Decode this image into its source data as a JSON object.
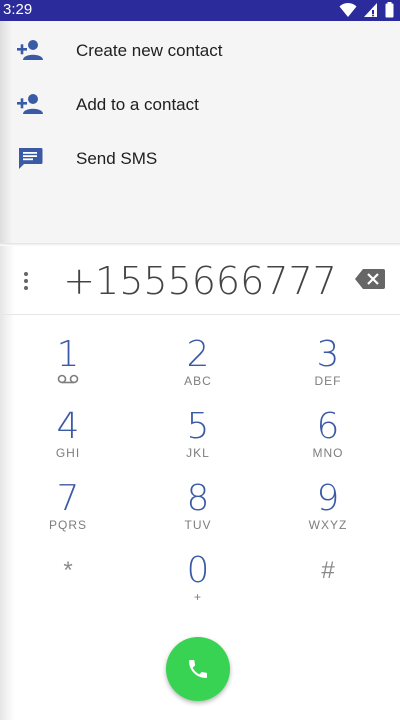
{
  "status_bar": {
    "time": "3:29",
    "icons": [
      "wifi-icon",
      "signal-icon",
      "battery-icon"
    ],
    "background": "#2b2b9b"
  },
  "actions": [
    {
      "label": "Create new contact",
      "icon": "person-add-icon"
    },
    {
      "label": "Add to a contact",
      "icon": "person-add-icon"
    },
    {
      "label": "Send SMS",
      "icon": "message-icon"
    }
  ],
  "dialer": {
    "number": "+1555666777",
    "keys": [
      {
        "digit": "1",
        "letters": ""
      },
      {
        "digit": "2",
        "letters": "ABC"
      },
      {
        "digit": "3",
        "letters": "DEF"
      },
      {
        "digit": "4",
        "letters": "GHI"
      },
      {
        "digit": "5",
        "letters": "JKL"
      },
      {
        "digit": "6",
        "letters": "MNO"
      },
      {
        "digit": "7",
        "letters": "PQRS"
      },
      {
        "digit": "8",
        "letters": "TUV"
      },
      {
        "digit": "9",
        "letters": "WXYZ"
      },
      {
        "digit": "*",
        "letters": ""
      },
      {
        "digit": "0",
        "letters": "+"
      },
      {
        "digit": "#",
        "letters": ""
      }
    ],
    "accent_color": "#3b5aa6",
    "call_color": "#39d353"
  }
}
